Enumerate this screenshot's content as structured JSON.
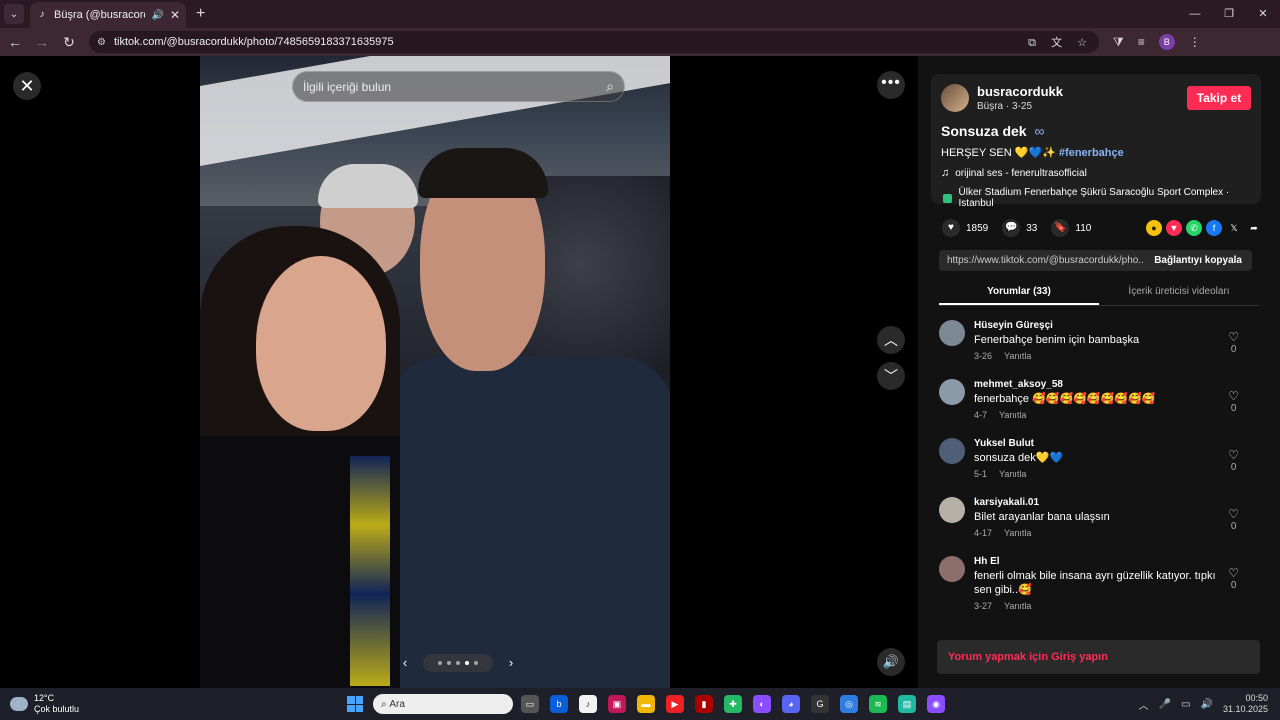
{
  "browser": {
    "tab_title": "Büşra (@busracordukk) | Tik",
    "url": "tiktok.com/@busracordukk/photo/7485659183371635975"
  },
  "viewer": {
    "search_placeholder": "İlgili içeriği bulun",
    "carousel_dots": 5,
    "carousel_active": 3
  },
  "post": {
    "username": "busracordukk",
    "author_sub": "Büşra · 3-25",
    "follow_label": "Takip et",
    "title": "Sonsuza dek",
    "title_symbol": "∞",
    "desc_text": "HERŞEY SEN 💛💙✨",
    "desc_tag": "#fenerbahçe",
    "music": "orijinal ses - fenerultrasofficial",
    "location": "Ülker Stadium Fenerbahçe Şükrü Saracoğlu Sport Complex · Istanbul",
    "likes": "1859",
    "comments_count": "33",
    "saves": "110",
    "share_link": "https://www.tiktok.com/@busracordukk/pho...",
    "copy_label": "Bağlantıyı kopyala",
    "tab_comments": "Yorumlar (33)",
    "tab_creator": "İçerik üreticisi videoları",
    "login_prompt": "Yorum yapmak için Giriş yapın"
  },
  "comments": [
    {
      "user": "Hüseyin Güreşçi",
      "text": "Fenerbahçe benim için bambaşka",
      "date": "3-26",
      "reply": "Yanıtla",
      "likes": "0"
    },
    {
      "user": "mehmet_aksoy_58",
      "text": "fenerbahçe 🥰🥰🥰🥰🥰🥰🥰🥰🥰",
      "date": "4-7",
      "reply": "Yanıtla",
      "likes": "0"
    },
    {
      "user": "Yuksel Bulut",
      "text": "sonsuza dek💛💙",
      "date": "5-1",
      "reply": "Yanıtla",
      "likes": "0"
    },
    {
      "user": "karsiyakali.01",
      "text": "Bilet arayanlar bana ulaşsın",
      "date": "4-17",
      "reply": "Yanıtla",
      "likes": "0"
    },
    {
      "user": "Hh El",
      "text": "fenerli olmak bile insana ayrı güzellik katıyor. tıpkı sen gibi..🥰",
      "date": "3-27",
      "reply": "Yanıtla",
      "likes": "0"
    }
  ],
  "taskbar": {
    "temp": "12°C",
    "weather": "Çok bulutlu",
    "search": "Ara",
    "time": "00:50",
    "date": "31.10.2025"
  }
}
